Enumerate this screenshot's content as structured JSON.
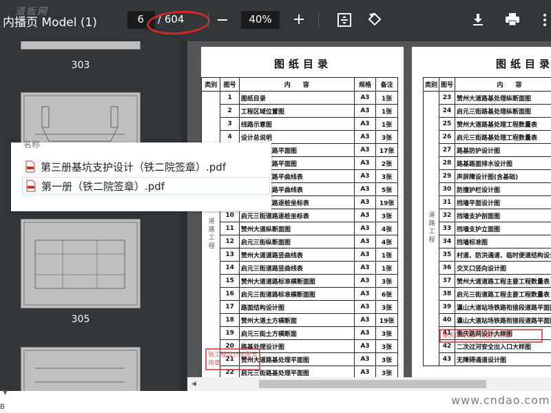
{
  "toolbar": {
    "title": "内播页 Model (1)",
    "watermark": "道板网",
    "page_current": "6",
    "page_total": "/ 604",
    "zoom": "40%",
    "icons": [
      "minus-icon",
      "plus-icon",
      "fit-page-icon",
      "rotate-icon",
      "download-icon",
      "print-icon",
      "more-icon"
    ]
  },
  "sidebar": {
    "thumbs": [
      {
        "label": "303"
      },
      {
        "label": ""
      },
      {
        "label": "305"
      },
      {
        "label": ""
      }
    ]
  },
  "popup": {
    "header": "名称",
    "files": [
      {
        "name": "第三册基坑支护设计（铁二院签章）.pdf"
      },
      {
        "name": "第一册（铁二院签章）.pdf"
      }
    ]
  },
  "sheet_left": {
    "title": "图纸目录",
    "headers": [
      "类别",
      "图号",
      "内　　容",
      "规格",
      "备注"
    ],
    "category": "道路工程",
    "rows": [
      {
        "no": "1",
        "name": "图纸目录",
        "size": "A3",
        "note": "1张"
      },
      {
        "no": "2",
        "name": "工程区域位置图",
        "size": "A3",
        "note": "1张"
      },
      {
        "no": "3",
        "name": "线路示意图",
        "size": "A3",
        "note": "1张"
      },
      {
        "no": "4",
        "name": "设计总说明",
        "size": "A3",
        "note": "3张"
      },
      {
        "no": "5",
        "name": "赞州大道道路平面图",
        "size": "A3",
        "note": "17张"
      },
      {
        "no": "6",
        "name": "启元三街道路平面图",
        "size": "A3",
        "note": "2张"
      },
      {
        "no": "7",
        "name": "赞州大道道路平曲线表",
        "size": "A3",
        "note": "3张"
      },
      {
        "no": "8",
        "name": "启元三街道路平曲线表",
        "size": "A3",
        "note": "5张"
      },
      {
        "no": "9",
        "name": "赞州大道道路逐桩坐标表",
        "size": "A3",
        "note": "19张"
      },
      {
        "no": "10",
        "name": "启元三街道路逐桩坐标表",
        "size": "A3",
        "note": "3张"
      },
      {
        "no": "11",
        "name": "赞州大道纵断面图",
        "size": "A3",
        "note": "4张"
      },
      {
        "no": "12",
        "name": "启元三街纵断面图",
        "size": "A3",
        "note": "4张"
      },
      {
        "no": "13",
        "name": "赞州大道道路竖曲线表",
        "size": "A3",
        "note": "1张"
      },
      {
        "no": "14",
        "name": "启元三街道路竖曲线表",
        "size": "A3",
        "note": "1张"
      },
      {
        "no": "15",
        "name": "赞州大道道路标准横断面图",
        "size": "A3",
        "note": "3张"
      },
      {
        "no": "16",
        "name": "启元三街道路标准横断面图",
        "size": "A3",
        "note": "6张"
      },
      {
        "no": "17",
        "name": "路面结构设计图",
        "size": "A3",
        "note": "3张"
      },
      {
        "no": "18",
        "name": "赞州大道土方横断面",
        "size": "A3",
        "note": "19张"
      },
      {
        "no": "19",
        "name": "启元三街土方横断面",
        "size": "A3",
        "note": "3张"
      },
      {
        "no": "20",
        "name": "路基处理设计图",
        "size": "A3",
        "note": "3张"
      },
      {
        "no": "21",
        "name": "赞州大道路基处理平面图",
        "size": "A3",
        "note": "3张"
      },
      {
        "no": "22",
        "name": "启元三街路基处理平面图",
        "size": "A3",
        "note": "3张"
      }
    ]
  },
  "sheet_right": {
    "title": "图纸目录",
    "headers": [
      "类别",
      "图号",
      "内　　容"
    ],
    "category": "道路工程",
    "rows": [
      {
        "no": "23",
        "name": "赞州大道路基处理纵断面图"
      },
      {
        "no": "24",
        "name": "启元三街路基处理纵断面图"
      },
      {
        "no": "25",
        "name": "赞州大道路基处理工程数量表"
      },
      {
        "no": "26",
        "name": "启元三街路基处理工程数量表"
      },
      {
        "no": "27",
        "name": "路基防护设计图"
      },
      {
        "no": "28",
        "name": "路基路面排水设计图"
      },
      {
        "no": "29",
        "name": "声屏障设计图(含基础)"
      },
      {
        "no": "30",
        "name": "防撞护栏设计图"
      },
      {
        "no": "31",
        "name": "挡墙平面设计图"
      },
      {
        "no": "32",
        "name": "挡墙支护剖面图"
      },
      {
        "no": "33",
        "name": "挡墙支护立面图"
      },
      {
        "no": "34",
        "name": "挡墙标准图"
      },
      {
        "no": "35",
        "name": "村道、防洪通道、临时便道结构设计图"
      },
      {
        "no": "36",
        "name": "交叉口竖向设计图"
      },
      {
        "no": "37",
        "name": "赞州大道道路工程主要工程数量表"
      },
      {
        "no": "38",
        "name": "启元三街道路工程主要工程数量表"
      },
      {
        "no": "39",
        "name": "瀛山大道站场铁路衔接段道路平面图"
      },
      {
        "no": "40",
        "name": "瀛山大道站场铁路衔接段道路平面图"
      },
      {
        "no": "41",
        "name": "重庆路网设计大样图"
      },
      {
        "no": "42",
        "name": "二次过河安全出入口大样图"
      },
      {
        "no": "43",
        "name": "无障碍通道设计图"
      }
    ]
  },
  "stamps": {
    "left": "铁工程设计出图专用章",
    "right": "重庆市政设计出图专用章"
  },
  "footer": {
    "watermark": "www.cndao.com",
    "bottom_left": "B"
  }
}
